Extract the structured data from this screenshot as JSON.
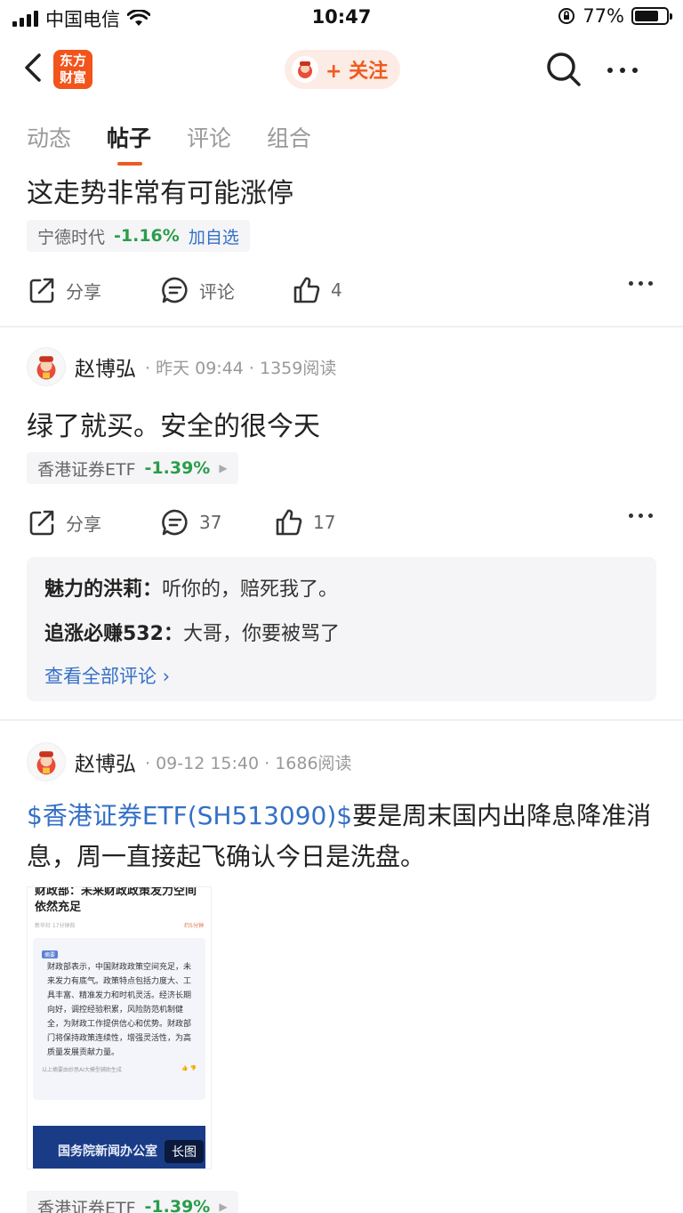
{
  "status_bar": {
    "carrier": "中国电信",
    "time": "10:47",
    "battery_percent": "77%",
    "battery_level": 0.77
  },
  "nav": {
    "logo_text_line1": "东方",
    "logo_text_line2": "财富",
    "follow_label": "+ 关注"
  },
  "tabs": [
    {
      "label": "动态",
      "active": false
    },
    {
      "label": "帖子",
      "active": true
    },
    {
      "label": "评论",
      "active": false
    },
    {
      "label": "组合",
      "active": false
    }
  ],
  "posts": [
    {
      "text": "这走势非常有可能涨停",
      "stock": {
        "name": "宁德时代",
        "change": "-1.16%",
        "add_label": "加自选"
      },
      "actions": {
        "share": "分享",
        "comment": "评论",
        "likes": "4"
      }
    },
    {
      "author": "赵博弘",
      "meta": "· 昨天 09:44 · 1359阅读",
      "text": "绿了就买。安全的很今天",
      "stock": {
        "name": "香港证券ETF",
        "change": "-1.39%"
      },
      "actions": {
        "share": "分享",
        "comment": "37",
        "likes": "17"
      },
      "comments": [
        {
          "user": "魅力的洪莉：",
          "text": "听你的，赔死我了。"
        },
        {
          "user": "追涨必赚532：",
          "text": "大哥，你要被骂了"
        }
      ],
      "view_all": "查看全部评论 ›"
    },
    {
      "author": "赵博弘",
      "meta": "· 09-12 15:40 · 1686阅读",
      "link_text": "$香港证券ETF(SH513090)$",
      "text": "要是周末国内出降息降准消息，周一直接起飞确认今日是洗盘。",
      "image": {
        "title": "财政部：未来财政政策发力空间依然充足",
        "source": "新华社  17分钟前",
        "listen": "约5分钟",
        "tag": "摘要",
        "body": "财政部表示，中国财政政策空间充足，未来发力有底气。政策特点包括力度大、工具丰富、精准发力和时机灵活。经济长期向好，调控经验积累，风险防范机制健全，为财政工作提供信心和优势。财政部门将保持政策连续性，增强灵活性，为高质量发展贡献力量。",
        "footnote": "以上摘要由妙思AI大模型辅助生成",
        "banner": "国务院新闻办公室",
        "long_badge": "长图"
      },
      "stock": {
        "name": "香港证券ETF",
        "change": "-1.39%"
      }
    }
  ]
}
